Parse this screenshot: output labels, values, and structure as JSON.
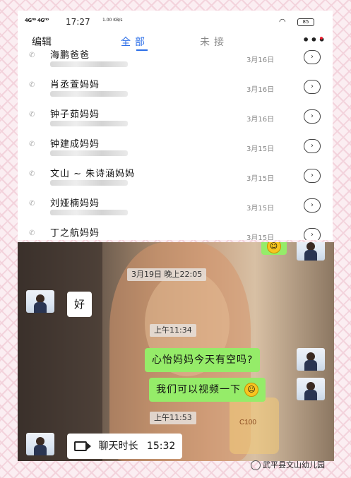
{
  "status_bar": {
    "signal": "4Gᴴᴰ 4Gᴴᴰ",
    "time": "17:27",
    "speed": "1.00 KB/s",
    "wifi_icon": "wifi-icon",
    "battery": "85"
  },
  "tabs": {
    "edit": "编辑",
    "all": "全部",
    "missed": "未接",
    "more": "•••"
  },
  "calls": [
    {
      "name": "海鹏爸爸",
      "date": "3月16日"
    },
    {
      "name": "肖丞萱妈妈",
      "date": "3月16日"
    },
    {
      "name": "钟子茹妈妈",
      "date": "3月16日"
    },
    {
      "name": "钟建成妈妈",
      "date": "3月15日"
    },
    {
      "name": "文山 ~ 朱诗涵妈妈",
      "date": "3月15日"
    },
    {
      "name": "刘娅楠妈妈",
      "date": "3月15日"
    },
    {
      "name": "丁之航妈妈",
      "date": "3月15日"
    }
  ],
  "chat": {
    "timestamp1": "3月19日 晚上22:05",
    "msg_in1": "好",
    "timestamp2": "上午11:34",
    "msg_out1": "心怡妈妈今天有空吗?",
    "msg_out2": "我们可以视频一下",
    "timestamp3": "上午11:53",
    "call_label": "聊天时长",
    "call_duration": "15:32",
    "sign_text": "C100"
  },
  "watermark": "武平县文山幼儿园",
  "colors": {
    "accent": "#2b6ee8",
    "bubble_out": "#95ec69",
    "frame": "#fbeef2"
  }
}
